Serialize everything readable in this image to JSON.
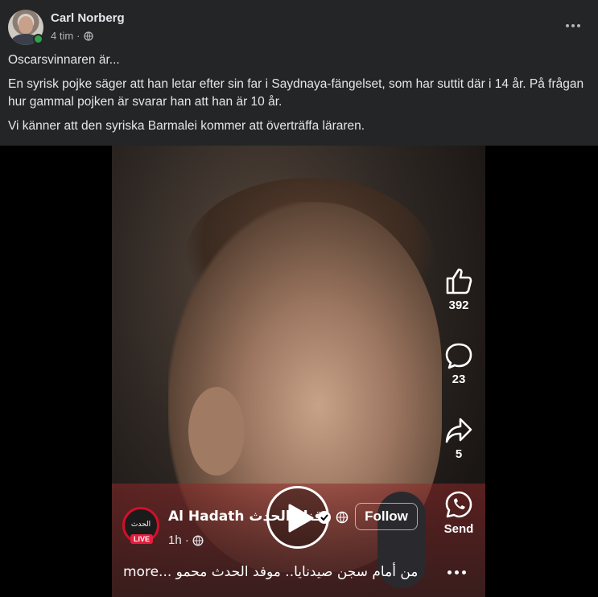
{
  "author": {
    "name": "Carl Norberg",
    "time": "4 tim",
    "separator": "·",
    "privacy_icon": "globe-icon",
    "online": true
  },
  "post": {
    "lines": [
      "Oscarsvinnaren är...",
      "En syrisk pojke säger att han letar efter sin far i Saydnaya-fängelset, som har suttit där i 14 år. På frågan hur gammal pojken är svarar han att han är 10 år.",
      "Vi känner att den syriska Barmalei kommer att överträffa läraren."
    ]
  },
  "video": {
    "play_icon": "play-icon",
    "actions": {
      "like_count": "392",
      "comment_count": "23",
      "share_count": "5",
      "send_label": "Send"
    },
    "channel": {
      "logo_text": "الحدث",
      "live_label": "LIVE",
      "name": "Al Hadath قناة الحدث",
      "follow_label": "Follow",
      "time": "1h ·"
    },
    "caption": "more... من أمام سجن صيدنايا.. موفد الحدث محمو"
  },
  "colors": {
    "background": "#242526",
    "text": "#e4e6eb",
    "muted": "#b0b3b8",
    "online": "#31a24c",
    "live": "#e41e3f"
  }
}
